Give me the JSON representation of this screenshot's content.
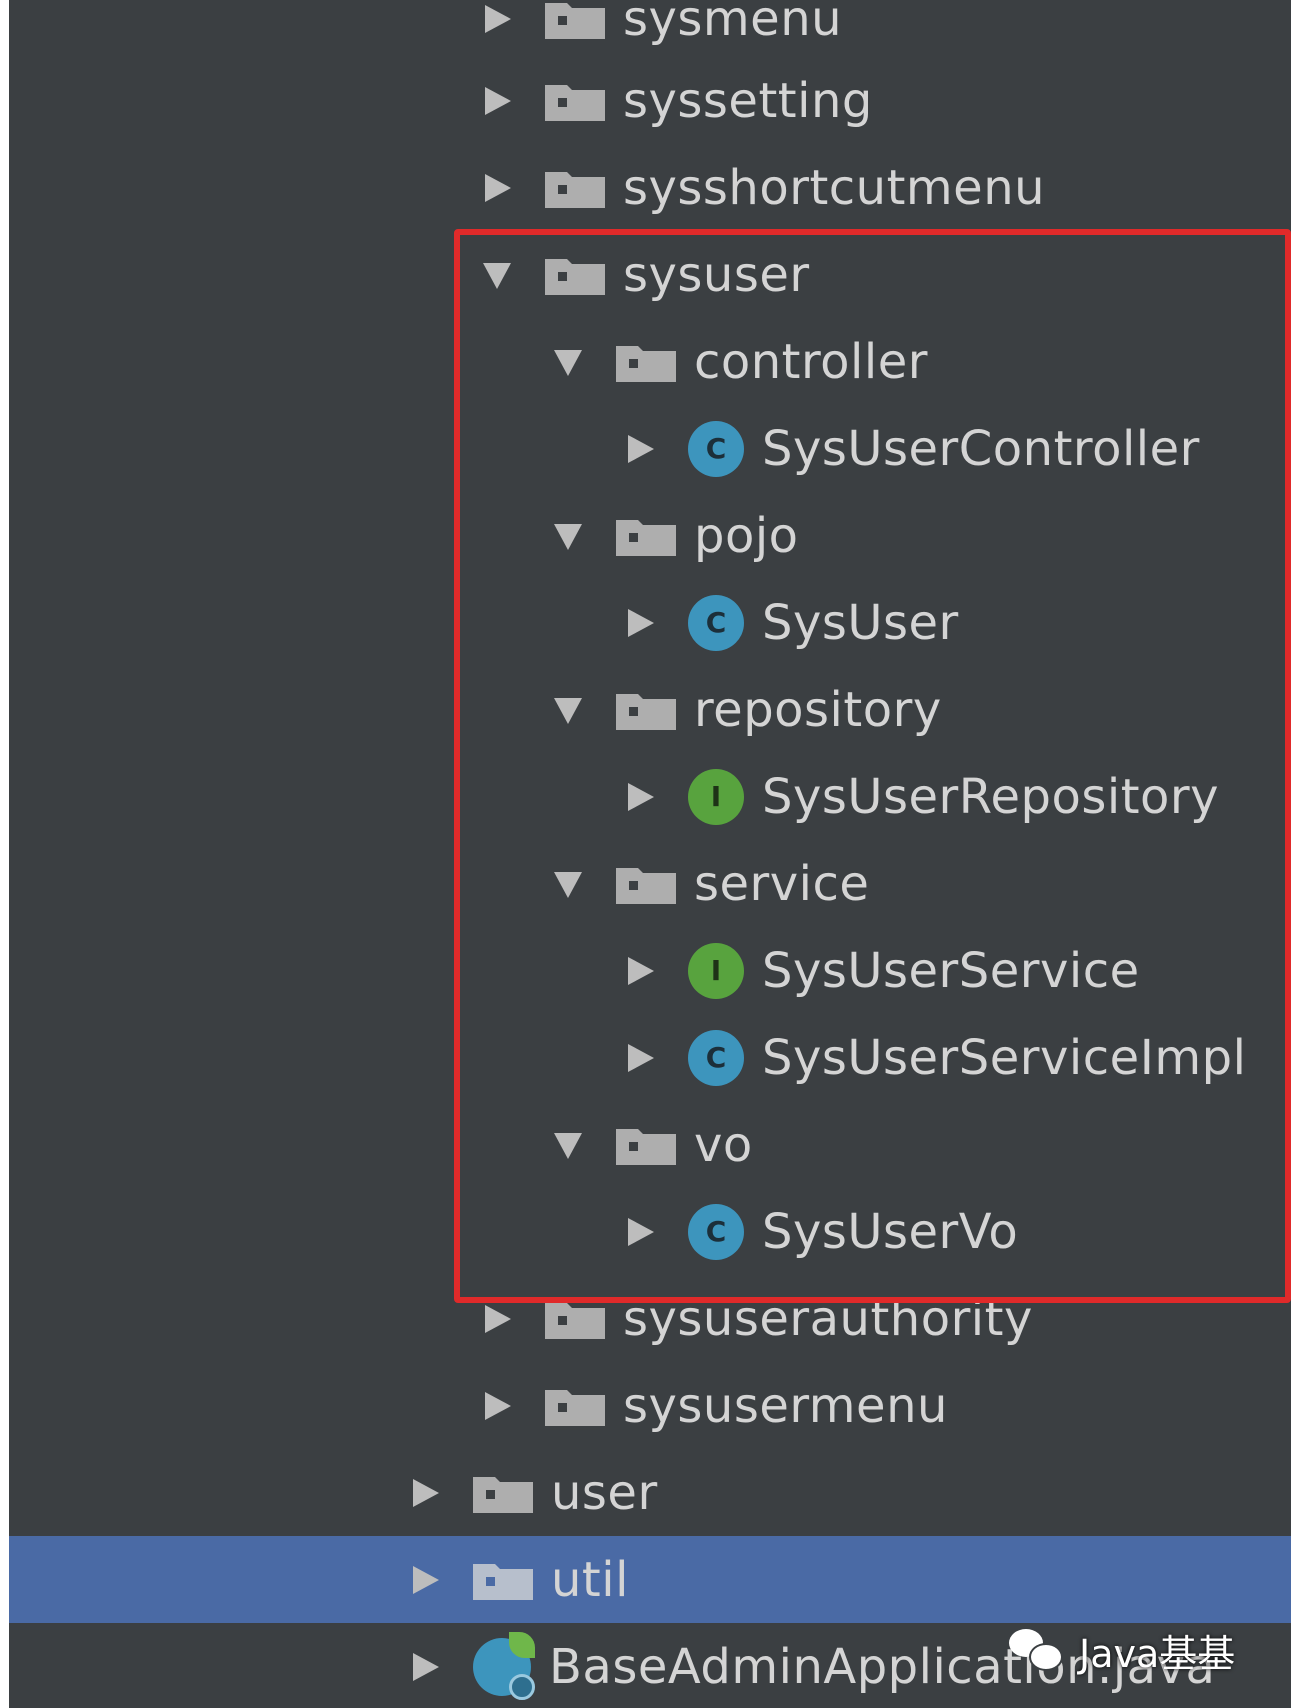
{
  "colors": {
    "panel_background": "#3b3f42",
    "selected_row": "#4a6aa5",
    "highlight_border": "#e02a2a",
    "class_icon": "#3d95bd",
    "interface_icon": "#58a33e",
    "text": "#d4d4d4"
  },
  "tree": {
    "items": [
      {
        "label": "sysmenu",
        "kind": "folder",
        "expanded": false,
        "depth": 2
      },
      {
        "label": "syssetting",
        "kind": "folder",
        "expanded": false,
        "depth": 2
      },
      {
        "label": "sysshortcutmenu",
        "kind": "folder",
        "expanded": false,
        "depth": 2
      },
      {
        "label": "sysuser",
        "kind": "folder",
        "expanded": true,
        "depth": 2
      },
      {
        "label": "controller",
        "kind": "folder",
        "expanded": true,
        "depth": 3
      },
      {
        "label": "SysUserController",
        "kind": "class",
        "icon_letter": "C",
        "depth": 4
      },
      {
        "label": "pojo",
        "kind": "folder",
        "expanded": true,
        "depth": 3
      },
      {
        "label": "SysUser",
        "kind": "class",
        "icon_letter": "C",
        "depth": 4
      },
      {
        "label": "repository",
        "kind": "folder",
        "expanded": true,
        "depth": 3
      },
      {
        "label": "SysUserRepository",
        "kind": "interface",
        "icon_letter": "I",
        "depth": 4
      },
      {
        "label": "service",
        "kind": "folder",
        "expanded": true,
        "depth": 3
      },
      {
        "label": "SysUserService",
        "kind": "interface",
        "icon_letter": "I",
        "depth": 4
      },
      {
        "label": "SysUserServiceImpl",
        "kind": "class",
        "icon_letter": "C",
        "depth": 4
      },
      {
        "label": "vo",
        "kind": "folder",
        "expanded": true,
        "depth": 3
      },
      {
        "label": "SysUserVo",
        "kind": "class",
        "icon_letter": "C",
        "depth": 4
      },
      {
        "label": "sysuserauthority",
        "kind": "folder",
        "expanded": false,
        "depth": 2
      },
      {
        "label": "sysusermenu",
        "kind": "folder",
        "expanded": false,
        "depth": 2
      },
      {
        "label": "user",
        "kind": "folder",
        "expanded": false,
        "depth": 1
      },
      {
        "label": "util",
        "kind": "folder",
        "expanded": false,
        "depth": 1,
        "selected": true
      },
      {
        "label": "BaseAdminApplication.java",
        "kind": "spring-app",
        "depth": 1
      }
    ]
  },
  "watermark": {
    "text": "Java基基",
    "icon": "wechat-icon"
  }
}
